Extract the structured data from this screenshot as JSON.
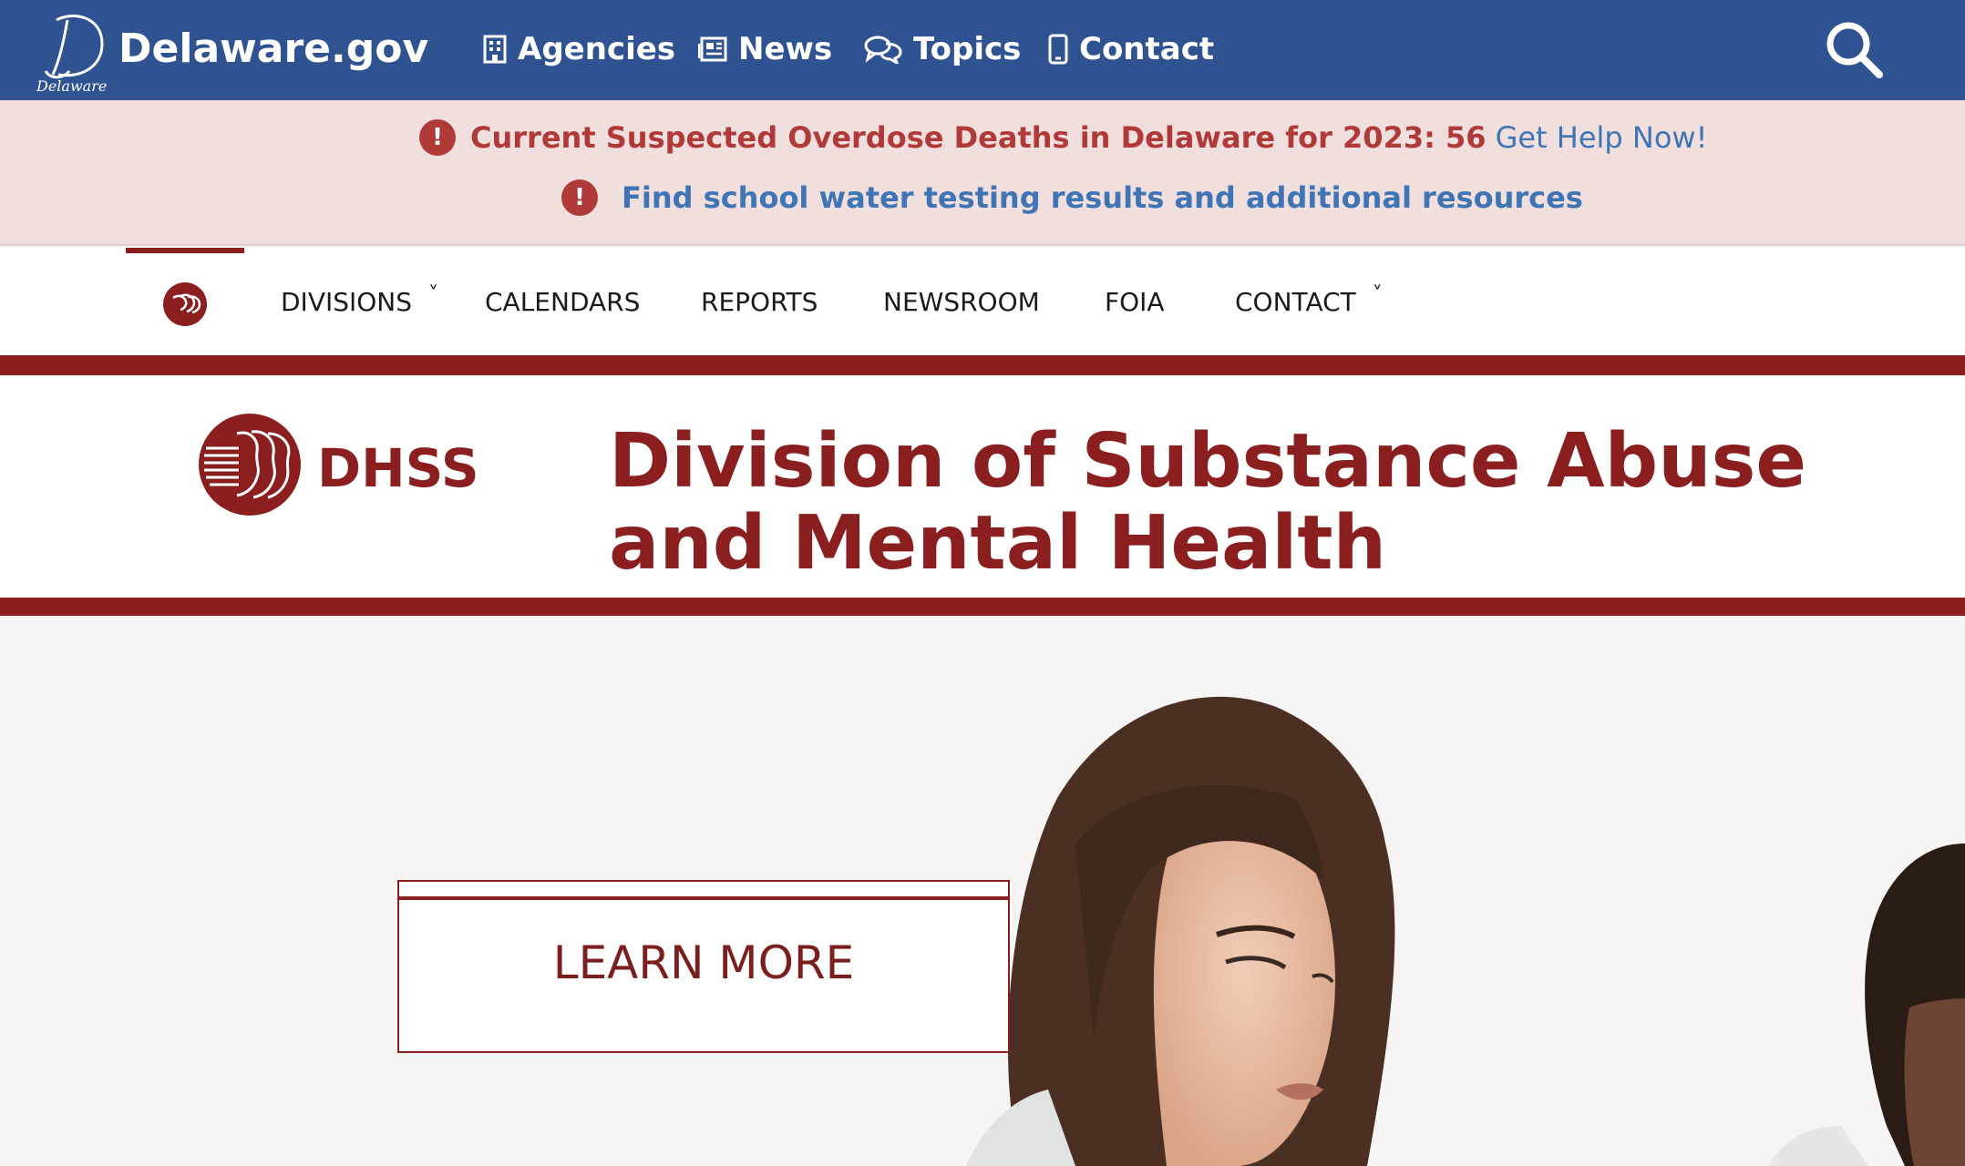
{
  "header": {
    "logo_caption": "Delaware",
    "site_name": "Delaware.gov",
    "nav": [
      {
        "label": "Agencies",
        "icon": "building-icon"
      },
      {
        "label": "News",
        "icon": "newspaper-icon"
      },
      {
        "label": "Topics",
        "icon": "chat-bubbles-icon"
      },
      {
        "label": "Contact",
        "icon": "mobile-phone-icon"
      }
    ],
    "search_icon": "search-icon"
  },
  "alerts": [
    {
      "text": "Current Suspected Overdose Deaths in Delaware for 2023: 56",
      "link": "Get Help Now!"
    },
    {
      "link": "Find school water testing results and additional resources"
    }
  ],
  "subnav": {
    "items": [
      {
        "label": "DIVISIONS",
        "has_dropdown": true
      },
      {
        "label": "CALENDARS",
        "has_dropdown": false
      },
      {
        "label": "REPORTS",
        "has_dropdown": false
      },
      {
        "label": "NEWSROOM",
        "has_dropdown": false
      },
      {
        "label": "FOIA",
        "has_dropdown": false
      },
      {
        "label": "CONTACT",
        "has_dropdown": true
      }
    ],
    "caret": "˅"
  },
  "agency": {
    "logo_text": "DHSS",
    "title": "Division of Substance Abuse and Mental Health"
  },
  "hero": {
    "cta_label": "LEARN MORE"
  },
  "colors": {
    "header_blue": "#2f5290",
    "accent_maroon": "#8b1e1e",
    "alert_bg": "#f1dfde",
    "alert_red": "#b03a3a",
    "link_blue": "#3f74b5"
  }
}
